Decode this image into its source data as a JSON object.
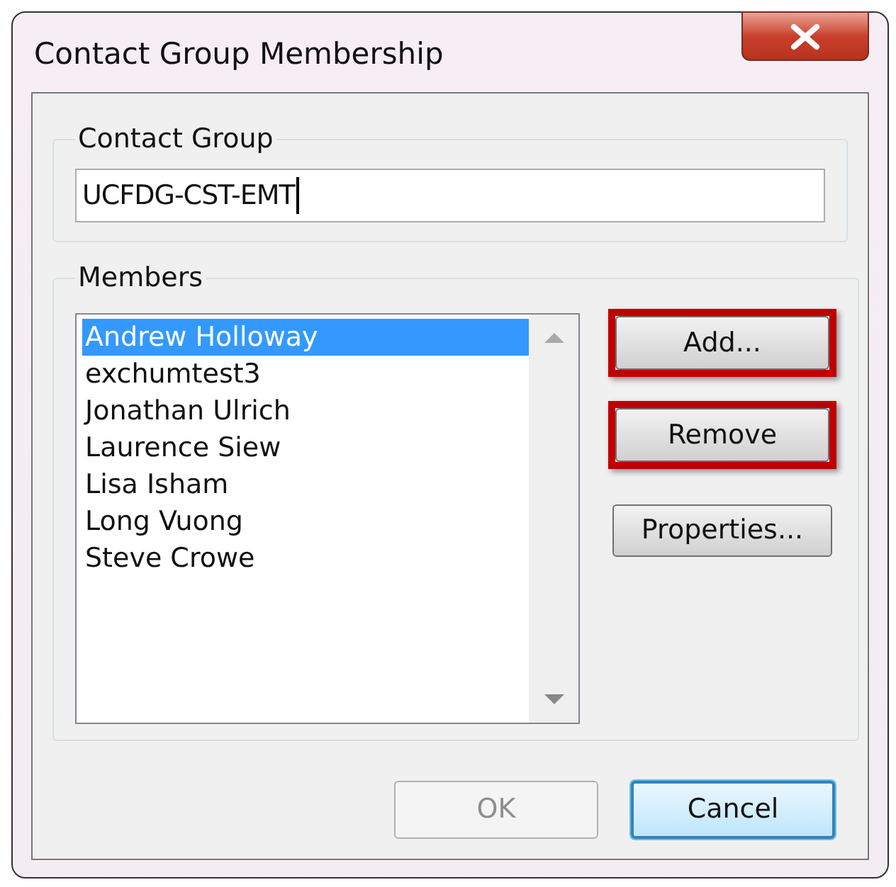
{
  "window": {
    "title": "Contact Group Membership"
  },
  "contact_group": {
    "label": "Contact Group",
    "value": "UCFDG-CST-EMT"
  },
  "members": {
    "label": "Members",
    "items": [
      {
        "name": "Andrew Holloway",
        "selected": true
      },
      {
        "name": "exchumtest3",
        "selected": false
      },
      {
        "name": "Jonathan Ulrich",
        "selected": false
      },
      {
        "name": "Laurence Siew",
        "selected": false
      },
      {
        "name": "Lisa Isham",
        "selected": false
      },
      {
        "name": "Long Vuong",
        "selected": false
      },
      {
        "name": "Steve Crowe",
        "selected": false
      }
    ]
  },
  "side_buttons": [
    {
      "label": "Add...",
      "highlighted": true
    },
    {
      "label": "Remove",
      "highlighted": true
    },
    {
      "label": "Properties...",
      "highlighted": false
    }
  ],
  "footer_buttons": [
    {
      "label": "OK",
      "disabled": true,
      "default": false
    },
    {
      "label": "Cancel",
      "disabled": false,
      "default": true
    }
  ]
}
